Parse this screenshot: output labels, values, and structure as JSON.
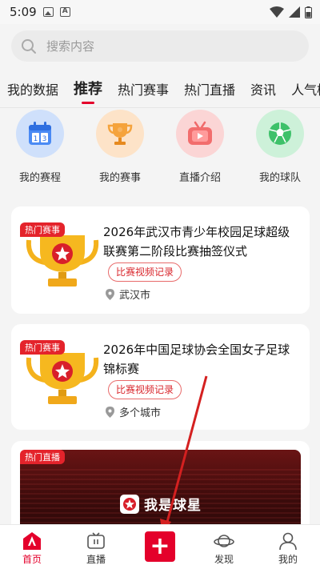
{
  "status_bar": {
    "time": "5:09"
  },
  "search": {
    "placeholder": "搜索内容"
  },
  "tabs": [
    {
      "label": "我的数据",
      "active": false
    },
    {
      "label": "推荐",
      "active": true
    },
    {
      "label": "热门赛事",
      "active": false
    },
    {
      "label": "热门直播",
      "active": false
    },
    {
      "label": "资讯",
      "active": false
    },
    {
      "label": "人气榜",
      "active": false
    }
  ],
  "quick_actions": [
    {
      "label": "我的赛程",
      "icon": "calendar-icon"
    },
    {
      "label": "我的赛事",
      "icon": "trophy-icon"
    },
    {
      "label": "直播介绍",
      "icon": "tv-icon"
    },
    {
      "label": "我的球队",
      "icon": "soccer-ball-icon"
    }
  ],
  "cards": [
    {
      "badge": "热门赛事",
      "title": "2026年武汉市青少年校园足球超级联赛第二阶段比赛抽签仪式",
      "tag": "比赛视频记录",
      "location": "武汉市"
    },
    {
      "badge": "热门赛事",
      "title": "2026年中国足球协会全国女子足球锦标赛",
      "tag": "比赛视频记录",
      "location": "多个城市"
    }
  ],
  "live_card": {
    "badge": "热门直播",
    "logo_text": "我是球星"
  },
  "bottom_nav": [
    {
      "label": "首页",
      "icon": "home-icon",
      "active": true
    },
    {
      "label": "直播",
      "icon": "tv-icon",
      "active": false
    },
    {
      "label": "+",
      "icon": "plus-icon",
      "active": false
    },
    {
      "label": "发现",
      "icon": "planet-icon",
      "active": false
    },
    {
      "label": "我的",
      "icon": "user-icon",
      "active": false
    }
  ],
  "colors": {
    "accent": "#e4002b",
    "background": "#f4f4f4"
  }
}
